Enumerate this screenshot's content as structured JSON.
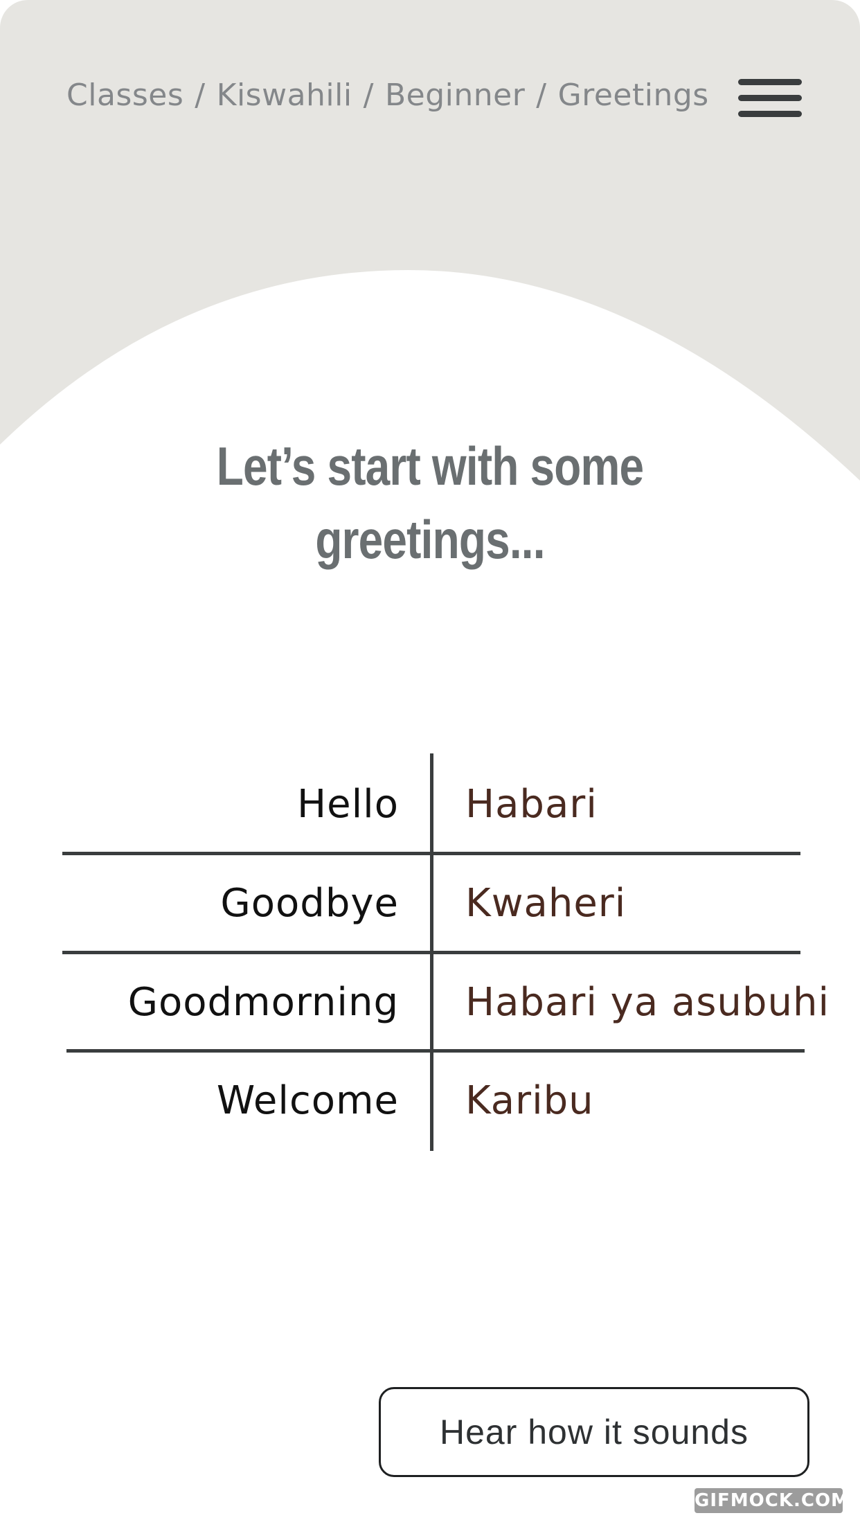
{
  "header": {
    "breadcrumb": [
      "Classes",
      "Kiswahili",
      "Beginner",
      "Greetings"
    ],
    "breadcrumb_separator": "/",
    "menu_icon": "hamburger-menu-icon",
    "background_color": "#e6e5e1"
  },
  "main": {
    "headline_line1": "Let’s start with some",
    "headline_line2": "greetings..."
  },
  "vocabulary": {
    "rows": [
      {
        "english": "Hello",
        "kiswahili": "Habari"
      },
      {
        "english": "Goodbye",
        "kiswahili": "Kwaheri"
      },
      {
        "english": "Goodmorning",
        "kiswahili": "Habari ya asubuhi"
      },
      {
        "english": "Welcome",
        "kiswahili": "Karibu"
      }
    ]
  },
  "actions": {
    "hear_button_label": "Hear how it sounds"
  },
  "watermark": "GIFMOCK.COM",
  "colors": {
    "header_bg": "#e6e5e1",
    "headline": "#6a6f71",
    "kiswahili_text": "#4a2a20",
    "dividers": "#3a3d3e"
  }
}
